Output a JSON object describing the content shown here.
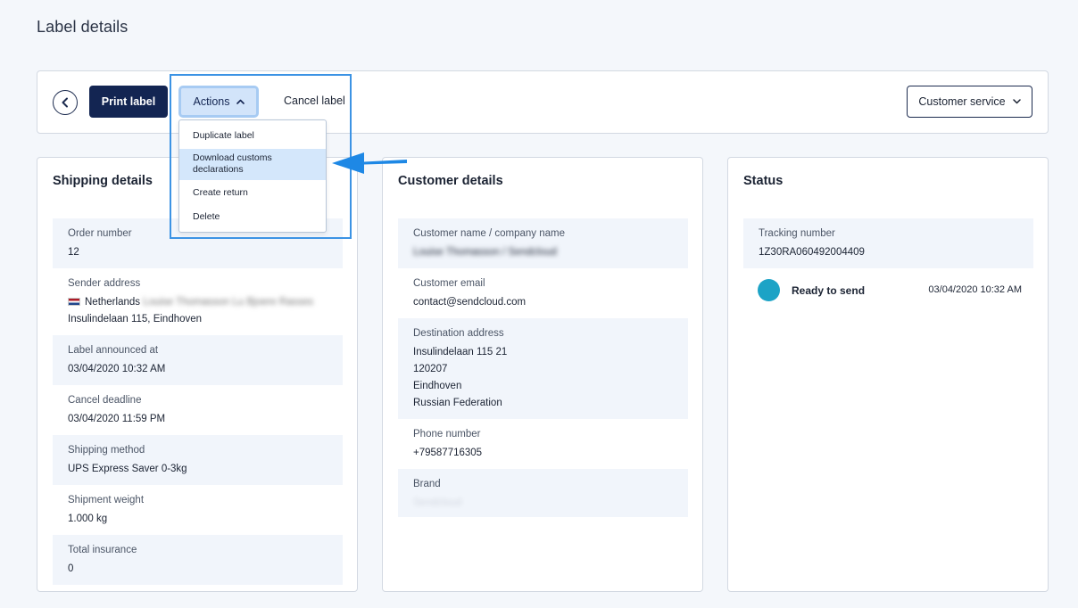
{
  "page": {
    "title": "Label details"
  },
  "toolbar": {
    "print_label": "Print label",
    "actions": "Actions",
    "cancel_label": "Cancel label",
    "customer_service": "Customer service"
  },
  "actions_menu": {
    "items": [
      "Duplicate label",
      "Download customs declarations",
      "Create return",
      "Delete"
    ],
    "download_line1": "Download customs",
    "download_line2": "declarations"
  },
  "shipping": {
    "title": "Shipping details",
    "order_number_label": "Order number",
    "order_number": "12",
    "sender_label": "Sender address",
    "sender_country": "Netherlands",
    "sender_name_blurred": "Louise Thomasson Lu Bjoere Rasses",
    "sender_street": "Insulindelaan 115, Eindhoven",
    "announced_label": "Label announced at",
    "announced": "03/04/2020 10:32 AM",
    "cancel_deadline_label": "Cancel deadline",
    "cancel_deadline": "03/04/2020 11:59 PM",
    "method_label": "Shipping method",
    "method": "UPS Express Saver 0-3kg",
    "weight_label": "Shipment weight",
    "weight": "1.000 kg",
    "insurance_label": "Total insurance",
    "insurance": "0"
  },
  "customer": {
    "title": "Customer details",
    "name_label": "Customer name / company name",
    "name_blurred": "Louise Thomasson / Sendcloud",
    "email_label": "Customer email",
    "email": "contact@sendcloud.com",
    "dest_label": "Destination address",
    "dest_line1": "Insulindelaan 115 21",
    "dest_line2": "120207",
    "dest_line3": "Eindhoven",
    "dest_line4": "Russian Federation",
    "phone_label": "Phone number",
    "phone": "+79587716305",
    "brand_label": "Brand",
    "brand_blurred": "Sendcloud"
  },
  "status": {
    "title": "Status",
    "tracking_label": "Tracking number",
    "tracking_number": "1Z30RA060492004409",
    "state": "Ready to send",
    "timestamp": "03/04/2020 10:32 AM",
    "dot_color": "#1ca3c6"
  },
  "colors": {
    "primary": "#132552",
    "link": "#1d67b8",
    "highlight": "#3c93e4"
  }
}
